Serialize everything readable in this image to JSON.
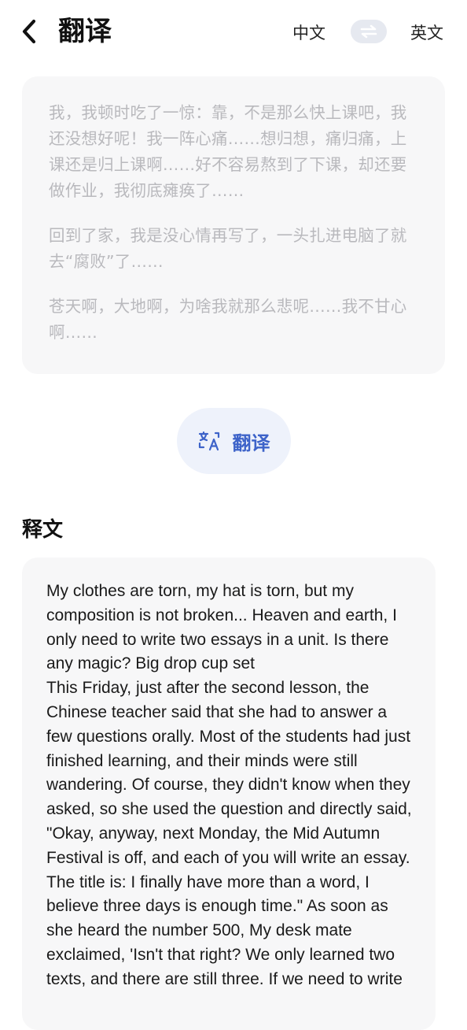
{
  "header": {
    "title": "翻译",
    "source_language": "中文",
    "target_language": "英文"
  },
  "source": {
    "paragraphs": [
      "我，我顿时吃了一惊：靠，不是那么快上课吧，我还没想好呢！我一阵心痛……想归想，痛归痛，上课还是归上课啊……好不容易熬到了下课，却还要做作业，我彻底瘫痪了……",
      "回到了家，我是没心情再写了，一头扎进电脑了就去“腐败”了……",
      "苍天啊，大地啊，为啥我就那么悲呢……我不甘心啊……"
    ]
  },
  "translate_button": {
    "label": "翻译"
  },
  "result": {
    "heading": "释文",
    "text": "My clothes are torn, my hat is torn, but my composition is not broken... Heaven and earth, I only need to write two essays in a unit. Is there any magic? Big drop cup set\nThis Friday, just after the second lesson, the Chinese teacher said that she had to answer a few questions orally. Most of the students had just finished learning, and their minds were still wandering. Of course, they didn't know when they asked, so she used the question and directly said, \"Okay, anyway, next Monday, the Mid Autumn Festival is off, and each of you will write an essay. The title is: I finally have more than a word, I believe three days is enough time.\" As soon as she heard the number 500, My desk mate exclaimed, 'Isn't that right? We only learned two texts, and there are still three. If we need to write"
  },
  "icons": {
    "back": "chevron-left-icon",
    "swap": "swap-arrows-icon",
    "translate": "translate-icon"
  },
  "colors": {
    "accent": "#3d63c9",
    "card_background": "#f7f7f8",
    "button_background": "#eef2fb",
    "swap_background": "#e6e9f0",
    "source_text": "#b9b9bd"
  }
}
